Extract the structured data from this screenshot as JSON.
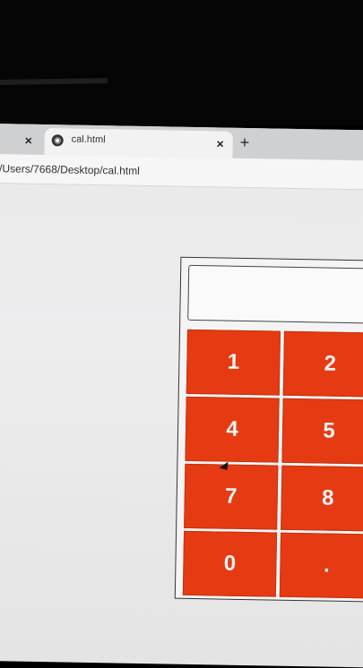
{
  "browser": {
    "tabs": [
      {
        "title": "",
        "close_icon": "×"
      },
      {
        "title": "cal.html",
        "icon": "globe-icon",
        "close_icon": "×"
      }
    ],
    "new_tab_label": "+",
    "url": "/Users/7668/Desktop/cal.html"
  },
  "calculator": {
    "display_value": "",
    "keys": [
      "1",
      "2",
      "4",
      "5",
      "7",
      "8",
      "0",
      "."
    ],
    "key_color": "#e63b12"
  }
}
